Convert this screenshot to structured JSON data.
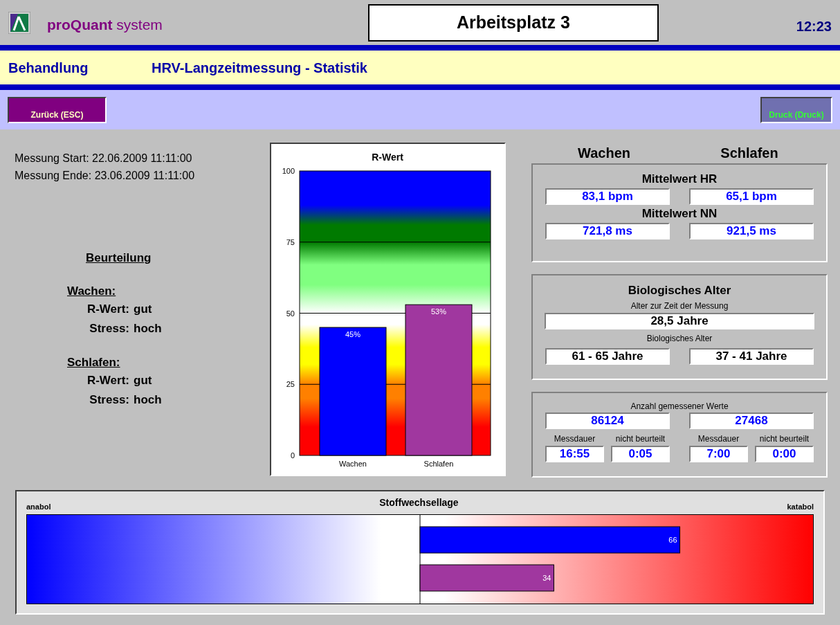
{
  "header": {
    "product_bold": "proQuant",
    "product_rest": "system",
    "workstation": "Arbeitsplatz 3",
    "time": "12:23"
  },
  "title_bar": {
    "section": "Behandlung",
    "page": "HRV-Langzeitmessung - Statistik"
  },
  "toolbar": {
    "back_button": "Zurück (ESC)",
    "print_button": "Druck (Druck)"
  },
  "measurement": [
    "Messung Start: 22.06.2009 11:11:00",
    "Messung Ende: 23.06.2009 11:11:00"
  ],
  "assessment": {
    "title": "Beurteilung",
    "groups": [
      {
        "label": "Wachen:",
        "rows": [
          {
            "label": "R-Wert:",
            "value": "gut"
          },
          {
            "label": "Stress:",
            "value": "hoch"
          }
        ]
      },
      {
        "label": "Schlafen:",
        "rows": [
          {
            "label": "R-Wert:",
            "value": "gut"
          },
          {
            "label": "Stress:",
            "value": "hoch"
          }
        ]
      }
    ]
  },
  "r_chart": {
    "chart_data": {
      "type": "bar",
      "title": "R-Wert",
      "categories": [
        "Wachen",
        "Schlafen"
      ],
      "series": [
        {
          "color": "#0000ff",
          "values": [
            45,
            null
          ],
          "value_labels": [
            "45%",
            null
          ]
        },
        {
          "color": "#a0379f",
          "values": [
            null,
            53
          ],
          "value_labels": [
            null,
            "53%"
          ]
        }
      ],
      "ylim": [
        0,
        100
      ],
      "yticks": [
        0,
        25,
        50,
        75,
        100
      ],
      "grid": true
    }
  },
  "columns": [
    "Wachen",
    "Schlafen"
  ],
  "mean_panel": [
    {
      "title": "Mittelwert HR",
      "values": [
        "83,1 bpm",
        "65,1 bpm"
      ]
    },
    {
      "title": "Mittelwert NN",
      "values": [
        "721,8 ms",
        "921,5 ms"
      ]
    }
  ],
  "bio_age": {
    "title": "Biologisches Alter",
    "age_label": "Alter zur Zeit der Messung",
    "age_value": "28,5 Jahre",
    "bio_label": "Biologisches Alter",
    "bio_values": [
      "61 - 65 Jahre",
      "37 - 41 Jahre"
    ]
  },
  "counts": {
    "title": "Anzahl gemessener Werte",
    "values": [
      "86124",
      "27468"
    ],
    "durations": [
      {
        "label": "Messdauer",
        "value": "16:55"
      },
      {
        "label": "nicht beurteilt",
        "value": "0:05"
      },
      {
        "label": "Messdauer",
        "value": "7:00"
      },
      {
        "label": "nicht beurteilt",
        "value": "0:00"
      }
    ]
  },
  "metabolism": {
    "left_label": "anabol",
    "right_label": "katabol",
    "chart_data": {
      "type": "bar",
      "title": "Stoffwechsellage",
      "orientation": "horizontal",
      "xlim": [
        -100,
        100
      ],
      "categories": [
        null,
        null
      ],
      "series": [
        {
          "values": [
            66,
            34
          ],
          "colors": [
            "#0000ff",
            "#a0379f"
          ]
        }
      ],
      "data_labels": true
    }
  }
}
